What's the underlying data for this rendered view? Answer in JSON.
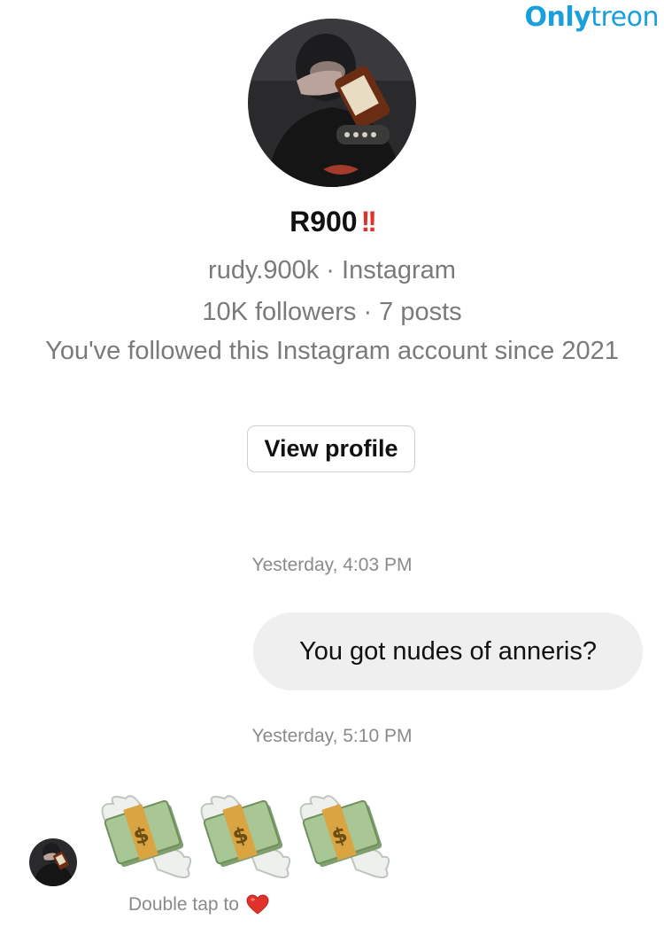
{
  "watermark": {
    "part1": "Only",
    "part2": "treon"
  },
  "profile": {
    "name": "R900",
    "name_emoji": "!!",
    "handle_line": "rudy.900k · Instagram",
    "stats_line": "10K followers · 7 posts",
    "follow_line": "You've followed this Instagram account since 2021",
    "view_profile_label": "View profile"
  },
  "messages": [
    {
      "timestamp": "Yesterday, 4:03 PM",
      "text": "You got nudes of anneris?",
      "sender": "me"
    },
    {
      "timestamp": "Yesterday, 5:10 PM",
      "emoji_count": 3,
      "emoji": "money-with-wings",
      "sender": "them",
      "hint": "Double tap to"
    }
  ],
  "colors": {
    "accent_watermark": "#19a0dc",
    "bubble": "#efefef",
    "heart": "#e0322b",
    "money_green": "#9fbf8a"
  }
}
